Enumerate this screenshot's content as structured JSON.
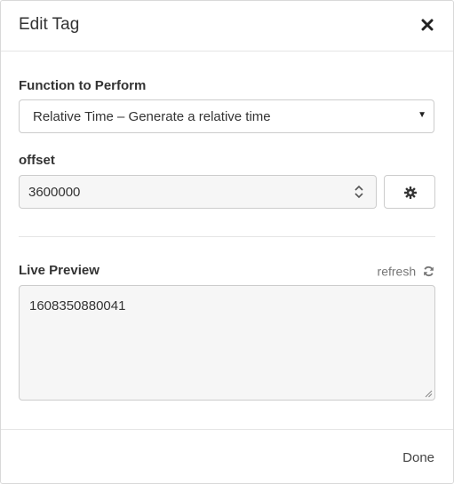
{
  "dialog": {
    "title": "Edit Tag",
    "close_icon": "close-icon"
  },
  "function_field": {
    "label": "Function to Perform",
    "selected": "Relative Time – Generate a relative time"
  },
  "offset_field": {
    "label": "offset",
    "value": "3600000"
  },
  "settings_button": {
    "icon": "gear-icon"
  },
  "preview": {
    "label": "Live Preview",
    "refresh_label": "refresh",
    "refresh_icon": "refresh-icon",
    "value": "1608350880041"
  },
  "footer": {
    "done_label": "Done"
  },
  "colors": {
    "text": "#333333",
    "muted": "#777777",
    "border": "#cccccc",
    "input_background": "#f6f6f6"
  }
}
